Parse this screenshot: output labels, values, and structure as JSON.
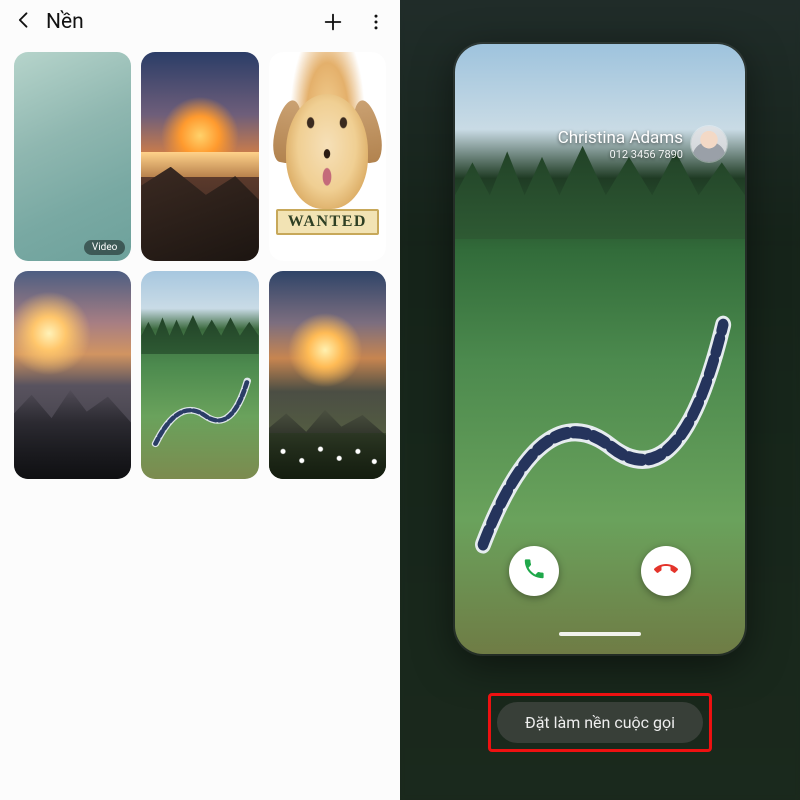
{
  "left": {
    "title": "Nền",
    "video_badge": "Video",
    "wanted_label": "WANTED"
  },
  "right": {
    "caller_name": "Christina Adams",
    "caller_number": "012 3456 7890",
    "set_button": "Đặt làm nền cuộc gọi"
  },
  "colors": {
    "accept": "#1fa84a",
    "decline": "#e4342b",
    "highlight": "#e11"
  }
}
